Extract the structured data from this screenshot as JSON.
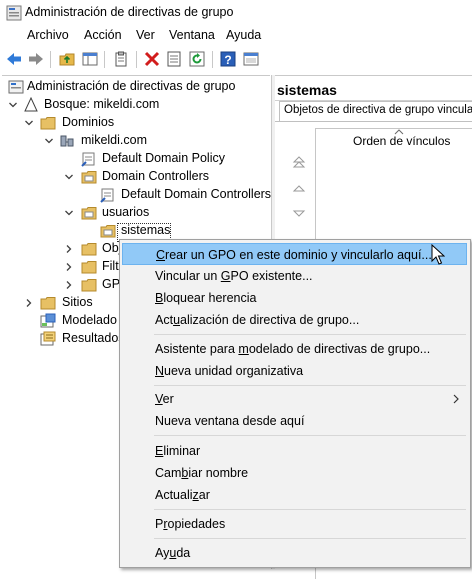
{
  "window": {
    "title": "Administración de directivas de grupo"
  },
  "menubar": [
    "Archivo",
    "Acción",
    "Ver",
    "Ventana",
    "Ayuda"
  ],
  "tree": [
    {
      "label": "Administración de directivas de grupo"
    },
    {
      "label": "Bosque: mikeldi.com"
    },
    {
      "label": "Dominios"
    },
    {
      "label": "mikeldi.com"
    },
    {
      "label": "Default Domain Policy"
    },
    {
      "label": "Domain Controllers"
    },
    {
      "label": "Default Domain Controllers"
    },
    {
      "label": "usuarios"
    },
    {
      "label": "sistemas"
    },
    {
      "label": "Obj"
    },
    {
      "label": "Filt"
    },
    {
      "label": "GPO"
    },
    {
      "label": "Sitios"
    },
    {
      "label": "Modelado"
    },
    {
      "label": "Resultados"
    }
  ],
  "right": {
    "title": "sistemas",
    "tab": "Objetos de directiva de grupo vinculados",
    "column": "Orden de vínculos"
  },
  "context_menu": {
    "items": [
      {
        "pre": "",
        "u": "C",
        "post": "rear un GPO en este dominio y vincularlo aquí..."
      },
      {
        "pre": "Vincular un ",
        "u": "G",
        "post": "PO existente..."
      },
      {
        "pre": "",
        "u": "B",
        "post": "loquear herencia"
      },
      {
        "pre": "Act",
        "u": "u",
        "post": "alización de directiva de grupo..."
      },
      {
        "pre": "Asistente para ",
        "u": "m",
        "post": "odelado de directivas de grupo..."
      },
      {
        "pre": "",
        "u": "N",
        "post": "ueva unidad organizativa"
      },
      {
        "pre": "",
        "u": "V",
        "post": "er"
      },
      {
        "pre": "Nueva ventana desde aquí",
        "u": "",
        "post": ""
      },
      {
        "pre": "",
        "u": "E",
        "post": "liminar"
      },
      {
        "pre": "Cam",
        "u": "b",
        "post": "iar nombre"
      },
      {
        "pre": "Actuali",
        "u": "z",
        "post": "ar"
      },
      {
        "pre": "P",
        "u": "r",
        "post": "opiedades"
      },
      {
        "pre": "Ay",
        "u": "u",
        "post": "da"
      }
    ],
    "highlight_color": "#91c9f7"
  }
}
